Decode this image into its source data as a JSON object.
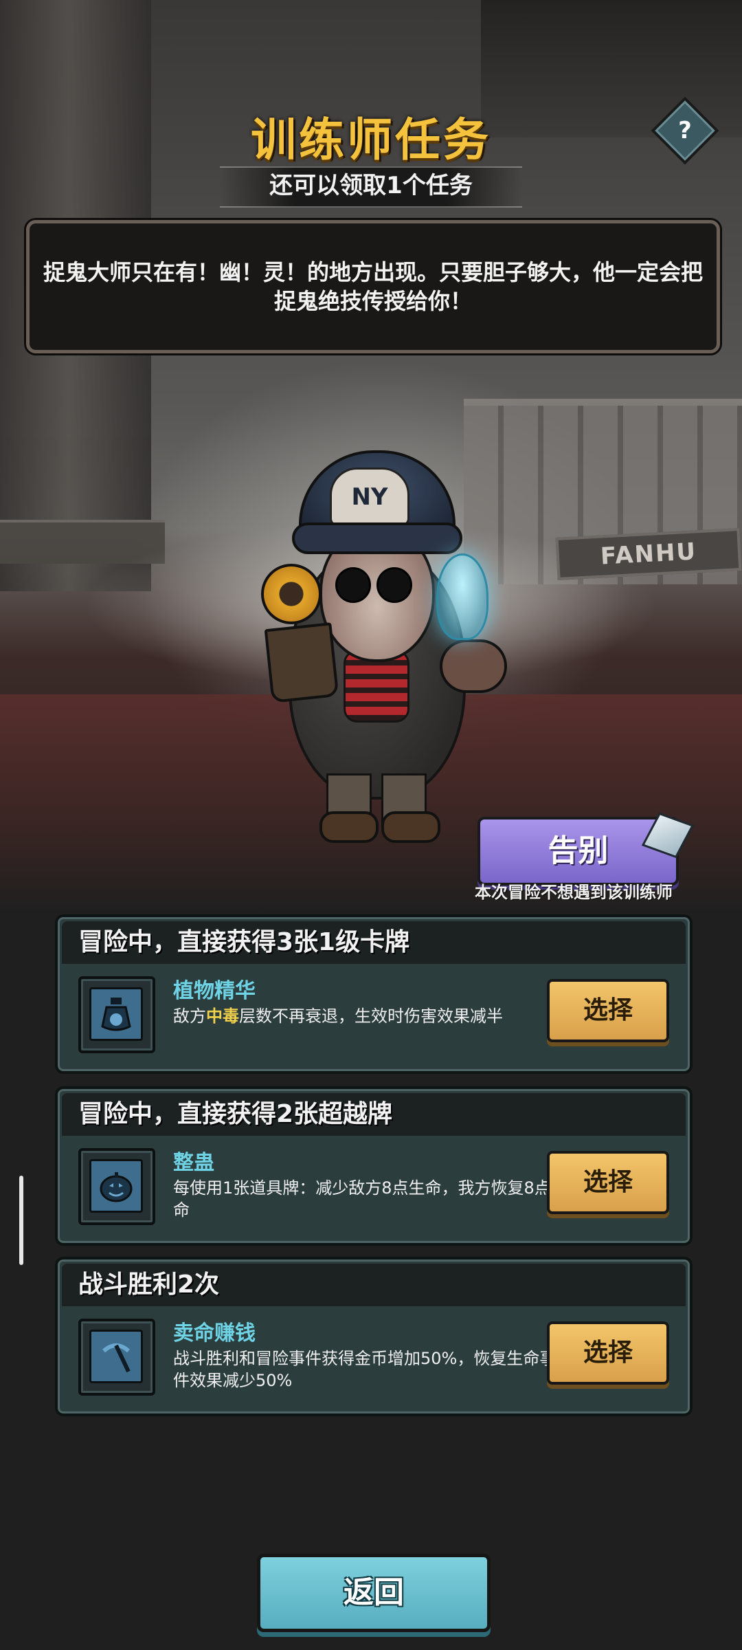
{
  "header": {
    "title": "训练师任务",
    "subtitle": "还可以领取1个任务",
    "help_label": "?"
  },
  "description": "捉鬼大师只在有！幽！灵！的地方出现。只要胆子够大，他一定会把捉鬼绝技传授给你！",
  "scene": {
    "sign_text": "FANHU",
    "cap_logo": "NY"
  },
  "farewell": {
    "label": "告别",
    "caption": "本次冒险不想遇到该训练师"
  },
  "tasks": [
    {
      "title": "冒险中，直接获得3张1级卡牌",
      "reward_name": "植物精华",
      "desc_before": "敌方",
      "desc_highlight": "中毒",
      "desc_after": "层数不再衰退，生效时伤害效果减半",
      "icon": "potion-icon",
      "button": "选择"
    },
    {
      "title": "冒险中，直接获得2张超越牌",
      "reward_name": "整蛊",
      "desc_before": "每使用1张道具牌：减少敌方8点生命，我方恢复8点生命",
      "desc_highlight": "",
      "desc_after": "",
      "icon": "pumpkin-icon",
      "button": "选择"
    },
    {
      "title": "战斗胜利2次",
      "reward_name": "卖命赚钱",
      "desc_before": "战斗胜利和冒险事件获得金币增加50%，恢复生命事件效果减少50%",
      "desc_highlight": "",
      "desc_after": "",
      "icon": "pickaxe-icon",
      "button": "选择"
    }
  ],
  "back_label": "返回",
  "colors": {
    "title": "#f5c23d",
    "reward_name": "#6fd3e6",
    "highlight": "#f3d24b",
    "farewell_button": "#8f7bd9",
    "select_button": "#e6b25a",
    "back_button": "#6cc3d1"
  }
}
